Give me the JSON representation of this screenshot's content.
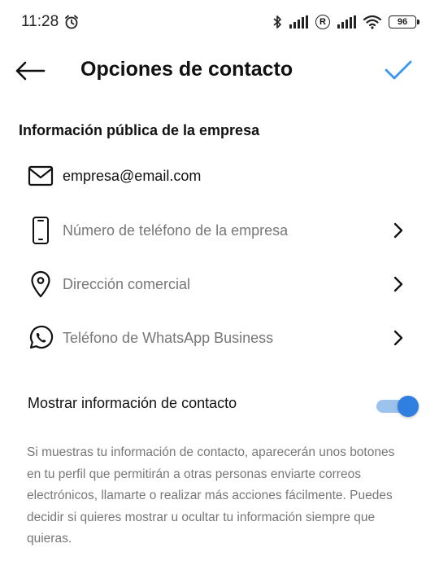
{
  "status_bar": {
    "time": "11:28",
    "battery": "96",
    "reg_symbol": "R"
  },
  "header": {
    "title": "Opciones de contacto",
    "accent_color": "#3897f0"
  },
  "section": {
    "title": "Información pública de la empresa"
  },
  "rows": [
    {
      "icon": "mail-icon",
      "label": "empresa@email.com",
      "filled": true
    },
    {
      "icon": "phone-icon",
      "label": "Número de teléfono de la empresa",
      "filled": false
    },
    {
      "icon": "location-pin-icon",
      "label": "Dirección comercial",
      "filled": false
    },
    {
      "icon": "whatsapp-icon",
      "label": "Teléfono de WhatsApp Business",
      "filled": false
    }
  ],
  "toggle": {
    "label": "Mostrar información de contacto",
    "on": true
  },
  "description": "Si muestras tu información de contacto, aparecerán unos botones en tu perfil que permitirán a otras personas enviarte correos electrónicos, llamarte o realizar más acciones fácilmente. Puedes decidir si quieres mostrar u ocultar tu información siempre que quieras."
}
